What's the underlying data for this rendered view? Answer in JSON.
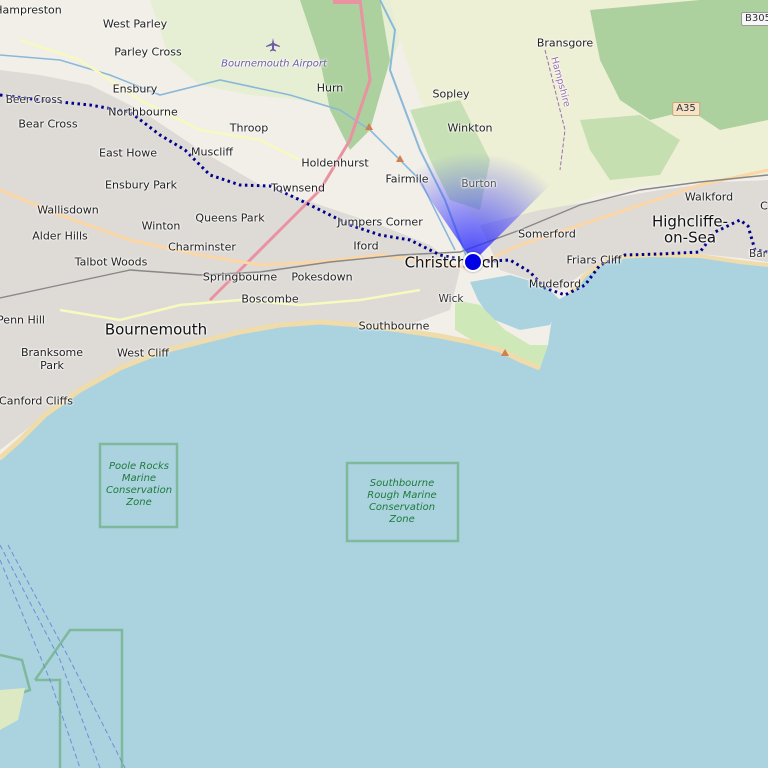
{
  "map": {
    "colors": {
      "sea": "#aad3df",
      "land": "#f2efe9",
      "urban": "#dcdcdc",
      "farmland": "#eef0d5",
      "woodland": "#add19e",
      "coast_sand": "#f5e9c6",
      "track": "#00008b",
      "marker": "#0000e6",
      "cone": "#3a3aff",
      "marine_zone": "#7fb89a"
    },
    "labels": {
      "hampreston": "Hampreston",
      "west_parley": "West Parley",
      "parley_cross": "Parley Cross",
      "bournemouth_airport": "Bournemouth Airport",
      "hurn": "Hurn",
      "bransgore": "Bransgore",
      "hampshire": "Hampshire",
      "sopley": "Sopley",
      "winkton": "Winkton",
      "beer_cross": "Beer Cross",
      "bear_cross": "Bear Cross",
      "ensbury": "Ensbury",
      "northbourne": "Northbourne",
      "throop": "Throop",
      "east_howe": "East Howe",
      "muscliff": "Muscliff",
      "holdenhurst": "Holdenhurst",
      "fairmile": "Fairmile",
      "burton": "Burton",
      "ensbury_park": "Ensbury Park",
      "townsend": "Townsend",
      "wallisdown": "Wallisdown",
      "queens_park": "Queens Park",
      "winton": "Winton",
      "jumpers_corner": "Jumpers Corner",
      "somerford": "Somerford",
      "walkford": "Walkford",
      "highcliffe": "Highcliffe-on-Sea",
      "alder_hills": "Alder Hills",
      "charminster": "Charminster",
      "iford": "Iford",
      "christchurch": "Christchurch",
      "friars_cliff": "Friars Cliff",
      "talbot_woods": "Talbot Woods",
      "springbourne": "Springbourne",
      "pokesdown": "Pokesdown",
      "mudeford": "Mudeford",
      "boscombe": "Boscombe",
      "wick": "Wick",
      "penn_hill": "Penn Hill",
      "bournemouth": "Bournemouth",
      "southbourne": "Southbourne",
      "branksome_park": "Branksome Park",
      "west_cliff": "West Cliff",
      "canford_cliffs": "Canford Cliffs",
      "barton": "Bar",
      "edge_c": "C",
      "poole_rocks": "Poole Rocks Marine Conservation Zone",
      "southbourne_rough": "Southbourne Rough Marine Conservation Zone"
    },
    "route_shields": {
      "a35": "A35",
      "b3055": "B305"
    },
    "icons": {
      "airport": "airplane-icon",
      "location_marker": "location-dot-icon",
      "peak": "peak-triangle-icon"
    }
  }
}
